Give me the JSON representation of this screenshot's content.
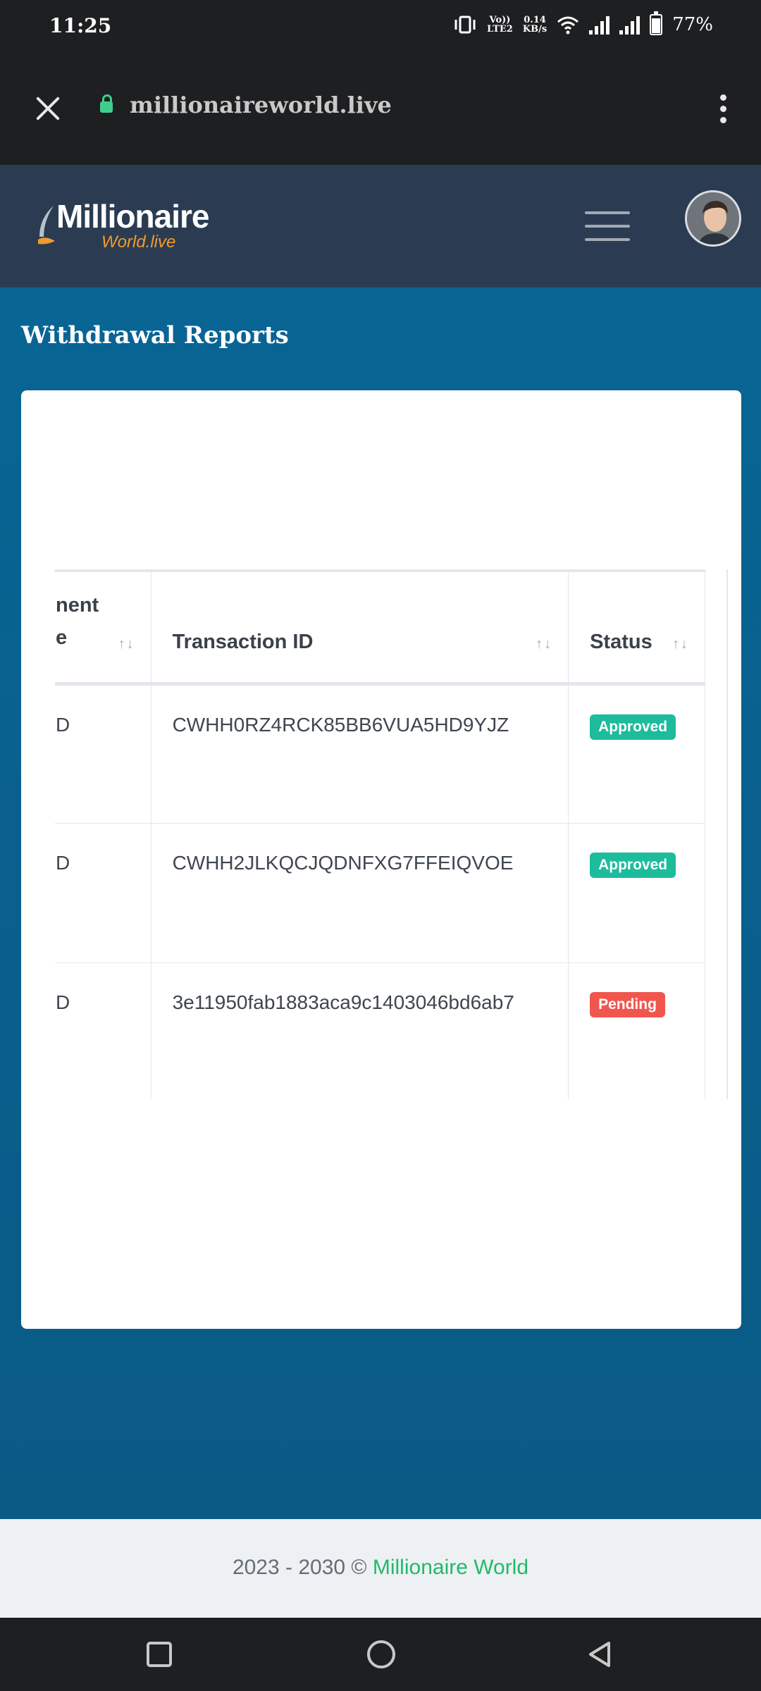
{
  "status_bar": {
    "time": "11:25",
    "volte": "Vo))",
    "lte": "LTE2",
    "net_speed": "0.14",
    "net_unit": "KB/s",
    "battery": "77%",
    "icons": [
      "vibrate-icon",
      "wifi-icon",
      "signal-icon",
      "signal-icon",
      "battery-icon"
    ]
  },
  "browser": {
    "url": "millionaireworld.live"
  },
  "header": {
    "logo_main": "Millionaire",
    "logo_sub": "World.live"
  },
  "page": {
    "title": "Withdrawal Reports"
  },
  "table": {
    "headers": {
      "col1_line1": "nent",
      "col1_line2": "e",
      "col2": "Transaction ID",
      "col3": "Status",
      "sort": "↑↓"
    },
    "rows": [
      {
        "col1": "D",
        "transaction_id": "CWHH0RZ4RCK85BB6VUA5HD9YJZ",
        "status": "Approved"
      },
      {
        "col1": "D",
        "transaction_id": "CWHH2JLKQCJQDNFXG7FFEIQVOE",
        "status": "Approved"
      },
      {
        "col1": "D",
        "transaction_id": "3e11950fab1883aca9c1403046bd6ab7",
        "status": "Pending"
      }
    ]
  },
  "footer": {
    "text": "2023 - 2030 © ",
    "link": "Millionaire World"
  },
  "colors": {
    "header_bg": "#2b3c52",
    "main_bg": "#086594",
    "approved": "#1cbc9c",
    "pending": "#f1564e",
    "footer_link": "#22b96b"
  }
}
